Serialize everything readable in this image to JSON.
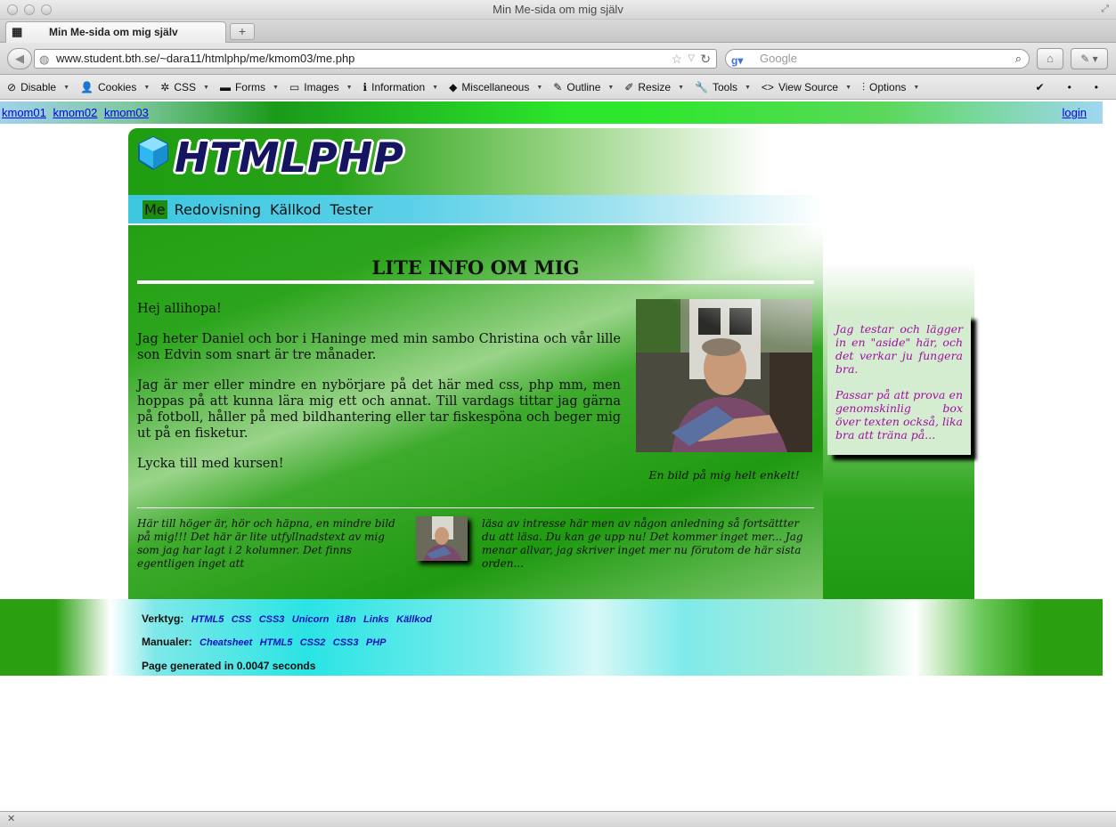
{
  "window": {
    "title": "Min Me-sida om mig själv"
  },
  "tab": {
    "title": "Min Me-sida om mig själv",
    "close": "✕",
    "new_tab": "+"
  },
  "nav": {
    "url": "www.student.bth.se/~dara11/htmlphp/me/kmom03/me.php",
    "search_placeholder": "Google"
  },
  "devbar": {
    "items": [
      "Disable",
      "Cookies",
      "CSS",
      "Forms",
      "Images",
      "Information",
      "Miscellaneous",
      "Outline",
      "Resize",
      "Tools",
      "View Source",
      "Options"
    ]
  },
  "sitebar": {
    "links": [
      "kmom01",
      "kmom02",
      "kmom03"
    ],
    "login": "login"
  },
  "site": {
    "logo": "HTMLPHP",
    "menu": [
      "Me",
      "Redovisning",
      "Källkod",
      "Tester"
    ],
    "active_menu": "Me"
  },
  "main": {
    "title": "LITE INFO OM MIG",
    "paragraphs": [
      "Hej allihopa!",
      "Jag heter Daniel och bor i Haninge med min sambo Christina och vår lille son Edvin som snart är tre månader.",
      "Jag är mer eller mindre en nybörjare på det här med css, php mm, men hoppas på att kunna lära mig ett och annat. Till vardags tittar jag gärna på fotboll, håller på med bildhantering eller tar fiskespöna och beger mig ut på en fisketur.",
      "Lycka till med kursen!"
    ],
    "photo_caption": "En bild på mig helt enkelt!",
    "col_left": "Här till höger är, hör och häpna, en mindre bild på mig!!! Det här är lite utfyllnadstext av mig som jag har lagt i 2 kolumner. Det finns egentligen inget att",
    "col_right": "läsa av intresse här men av någon anledning så fortsättter du att läsa. Du kan ge upp nu! Det kommer inget mer... Jag menar allvar, jag skriver inget mer nu förutom de här sista orden..."
  },
  "aside": {
    "p1": "Jag testar och lägger in en \"aside\" här, och det verkar ju fungera bra.",
    "p2": "Passar på att prova en genomskinlig box över texten också, lika bra att träna på..."
  },
  "footer": {
    "tools_label": "Verktyg:",
    "tools": [
      "HTML5",
      "CSS",
      "CSS3",
      "Unicorn",
      "i18n",
      "Links",
      "Källkod"
    ],
    "manuals_label": "Manualer:",
    "manuals": [
      "Cheatsheet",
      "HTML5",
      "CSS2",
      "CSS3",
      "PHP"
    ],
    "generated": "Page generated in 0.0047 seconds"
  },
  "colors": {
    "green": "#1f9e12",
    "cyan": "#2ae4e4",
    "aside_text": "#a010a0",
    "link": "#0000ee"
  }
}
